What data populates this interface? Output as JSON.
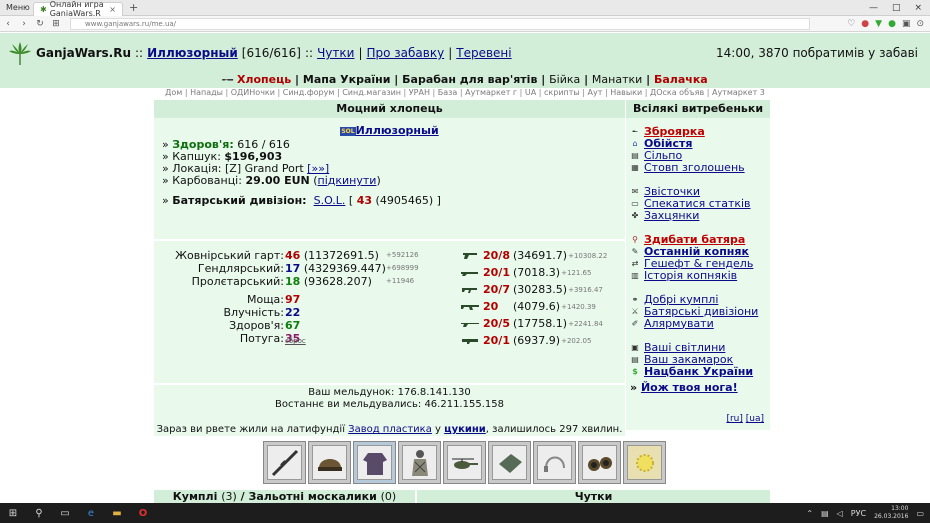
{
  "browser": {
    "menu_tab": "Меню",
    "active_tab": "Онлайн игра GanjaWars.R",
    "url": "www.ganjawars.ru/me.ua/"
  },
  "header": {
    "brand": "GanjaWars.Ru",
    "sep1": "::",
    "user_name": "Иллюзорный",
    "hp": "[616/616]",
    "sep2": "::",
    "link_chutky": "Чутки",
    "link_pro": "Про забавку",
    "link_tereveni": "Теревені",
    "right_text": "14:00, 3870 побратимів у забаві"
  },
  "mainmenu": {
    "items": [
      "Хлопець",
      "Мапа України",
      "Барабан для вар'ятів",
      "Бійка",
      "Манатки",
      "Балачка"
    ]
  },
  "submenu": {
    "items": [
      "Дом",
      "Напады",
      "ОДИНочки",
      "Синд.форум",
      "Синд.магазин",
      "УРАН",
      "База",
      "Аутмаркет г",
      "UA",
      "скрипты",
      "Аут",
      "Навыки",
      "ДОска объяв",
      "Аутмаркет 3"
    ]
  },
  "left_panel": {
    "title": "Моцний хлопець",
    "badge": "SOL",
    "char_name": "Иллюзорный",
    "health_label": "Здоров'я:",
    "health_value": "616 / 616",
    "wallet_label": "Капшук:",
    "wallet_value": "$196,903",
    "location_label": "Локація:",
    "location_value": "[Z] Grand Port",
    "location_link": "[»»]",
    "karb_label": "Карбованці:",
    "karb_value": "29.00 EUN",
    "karb_link": "підкинути",
    "division_label": "Батярський дивізіон:",
    "division_name": "S.O.L.",
    "division_rank": "43",
    "division_points": "(4905465)",
    "stats": [
      {
        "label": "Жовнірський гарт:",
        "lvl": "46",
        "val": "(11372691.5)",
        "delta": "+592126"
      },
      {
        "label": "Гендлярський:",
        "lvl": "17",
        "val": "(4329369.447)",
        "delta": "+698999"
      },
      {
        "label": "Пролєтарський:",
        "lvl": "18",
        "val": "(93628.207)",
        "delta": "+11946"
      },
      {
        "label": "Моща:",
        "lvl": "97",
        "val": "",
        "delta": ""
      },
      {
        "label": "Влучність:",
        "lvl": "22",
        "val": "",
        "delta": ""
      },
      {
        "label": "Здоров'я:",
        "lvl": "67",
        "val": "",
        "delta": ""
      },
      {
        "label": "Потуга:",
        "lvl": "35",
        "val": "",
        "delta": ""
      }
    ],
    "reset_link": "сброс",
    "weapons": [
      {
        "lvl": "20/8",
        "val": "(34691.7)",
        "delta": "+10308.22"
      },
      {
        "lvl": "20/1",
        "val": "(7018.3)",
        "delta": "+121.65"
      },
      {
        "lvl": "20/7",
        "val": "(30283.5)",
        "delta": "+3916.47"
      },
      {
        "lvl": "20",
        "val": "(4079.6)",
        "delta": "+1420.39"
      },
      {
        "lvl": "20/5",
        "val": "(17758.1)",
        "delta": "+2241.84"
      },
      {
        "lvl": "20/1",
        "val": "(6937.9)",
        "delta": "+202.05"
      }
    ],
    "ip_line": "Ваш мельдунок: 176.8.141.130",
    "last_ip_line": "Востаннє ви мельдувались: 46.211.155.158",
    "work_pre": "Зараз ви рвете жили на латифундії",
    "work_link": "Завод пластика",
    "work_mid": "у",
    "work_who": "цукини",
    "work_post": ", залишилось 297 хвилин."
  },
  "right_panel": {
    "title": "Всілякі витребеньки",
    "items": [
      {
        "label": "Зброярка",
        "style": "red"
      },
      {
        "label": "Обійстя",
        "style": "bold"
      },
      {
        "label": "Сільпо",
        "style": ""
      },
      {
        "label": "Стовп зголошень",
        "style": ""
      },
      {
        "label": "Звісточки",
        "style": ""
      },
      {
        "label": "Спекатися статків",
        "style": ""
      },
      {
        "label": "Захцянки",
        "style": ""
      },
      {
        "label": "Здибати батяра",
        "style": "red"
      },
      {
        "label": "Останній копняк",
        "style": "bold"
      },
      {
        "label": "Гешефт & гендель",
        "style": ""
      },
      {
        "label": "Історія копняків",
        "style": ""
      },
      {
        "label": "Добрі кумплі",
        "style": ""
      },
      {
        "label": "Батярські дивізіони",
        "style": ""
      },
      {
        "label": "Алярмувати",
        "style": ""
      },
      {
        "label": "Ваші світлини",
        "style": ""
      },
      {
        "label": "Ваш закамарок",
        "style": ""
      },
      {
        "label": "Нацбанк України",
        "style": "bold"
      }
    ],
    "hoj": "Йож твоя нога!",
    "lang_ru": "[ru]",
    "lang_ua": "[ua]"
  },
  "bottom": {
    "friends_label": "Кумплі",
    "friends_count": "(3)",
    "enemies_label": "Зальотні москалики",
    "enemies_count": "(0)",
    "rumors_label": "Чутки"
  },
  "taskbar": {
    "lang": "РУС",
    "time": "13:00",
    "date": "26.03.2016"
  }
}
